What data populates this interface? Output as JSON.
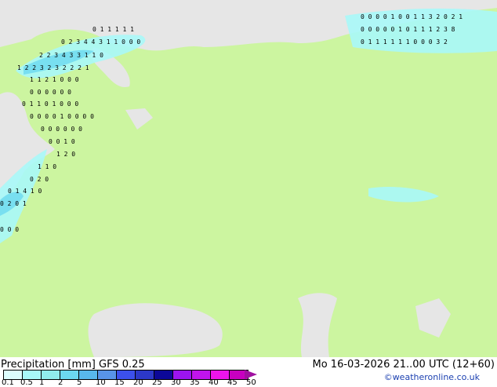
{
  "title": "Precipitation [mm]  GFS 0.25",
  "datetime": "Mo 16-03-2026 21..00 UTC (12+60)",
  "credit": "©weatheronline.co.uk",
  "legend": {
    "ticks": [
      "0.1",
      "0.5",
      "1",
      "2",
      "5",
      "10",
      "15",
      "20",
      "25",
      "30",
      "35",
      "40",
      "45",
      "50"
    ],
    "colors": [
      "#dcfcfc",
      "#a8f8f8",
      "#90ecec",
      "#6cd8f0",
      "#58b8ec",
      "#5894e8",
      "#3c50ec",
      "#2c38c8",
      "#0c0898",
      "#9c14f0",
      "#c014ec",
      "#ec14ec",
      "#c800c0"
    ],
    "arrow_color": "#a010a0"
  },
  "map": {
    "land_color": "#ccf5a0",
    "sea_color": "#e6e6e6",
    "labels": [
      {
        "t": "0 1 1 1 1 1",
        "r": 0
      },
      {
        "t": "0 2 3 4 4 3 1 1 0 0   0",
        "r": 1
      },
      {
        "t": "2 2 3 4 3 3 1 1 0",
        "r": 2
      },
      {
        "t": "1 2 2 3 2 3 2 2 2 1",
        "r": 3
      },
      {
        "t": "1 1 2 1 0    0 0",
        "r": 4
      },
      {
        "t": "0 0 0 0 0 0",
        "r": 5
      },
      {
        "t": "0 1 1 0 1 0   0 0",
        "r": 6
      },
      {
        "t": "0 0 0 0 1 0 0 0 0",
        "r": 7
      },
      {
        "t": "0 0 0 0 0 0",
        "r": 8
      },
      {
        "t": "0 0 1 0",
        "r": 9
      },
      {
        "t": "1 2 0",
        "r": 10
      },
      {
        "t": "1 1 0",
        "r": 11
      },
      {
        "t": "0 2 0",
        "r": 12
      },
      {
        "t": "0 1 4 1 0",
        "r": 13
      },
      {
        "t": "0 2 0 1",
        "r": 14
      },
      {
        "t": "0 0 0",
        "r": 15
      }
    ],
    "ne_labels": [
      "0 0 0 0 1 0 0 1 1 3 2 0 2 1",
      "0 0 0 0 0 1 0 1 1 1 2 3 8",
      "0 1 1 1 1 1 1 0 0   0 3 2"
    ]
  }
}
